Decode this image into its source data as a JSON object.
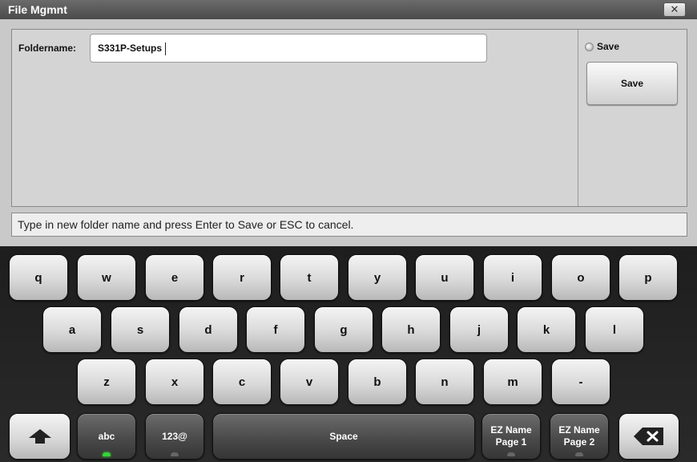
{
  "window": {
    "title": "File Mgmnt",
    "close_label": "✕"
  },
  "form": {
    "foldername_label": "Foldername:",
    "foldername_value": "S331P-Setups"
  },
  "side": {
    "radio_label": "Save",
    "save_button_label": "Save"
  },
  "status": {
    "message": "Type in new folder name and press Enter to Save or ESC to cancel."
  },
  "keyboard": {
    "row1": [
      "q",
      "w",
      "e",
      "r",
      "t",
      "y",
      "u",
      "i",
      "o",
      "p"
    ],
    "row2": [
      "a",
      "s",
      "d",
      "f",
      "g",
      "h",
      "j",
      "k",
      "l"
    ],
    "row3": [
      "z",
      "x",
      "c",
      "v",
      "b",
      "n",
      "m",
      "-"
    ],
    "shift_icon": "shift-arrow-icon",
    "abc_label": "abc",
    "num_label": "123@",
    "space_label": "Space",
    "ez1_line1": "EZ Name",
    "ez1_line2": "Page 1",
    "ez2_line1": "EZ Name",
    "ez2_line2": "Page 2",
    "backspace_icon": "backspace-icon",
    "active_mode": "abc",
    "colors": {
      "led_on": "#35d435",
      "led_off": "#666666"
    }
  }
}
